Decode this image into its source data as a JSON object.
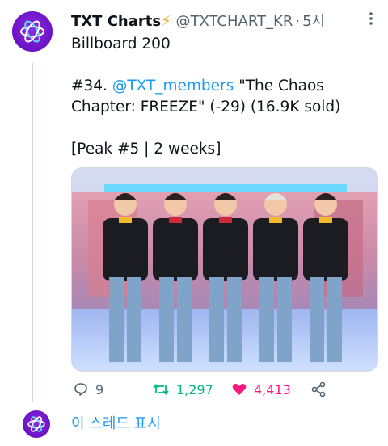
{
  "tweet": {
    "display_name": "TXT Charts",
    "name_emoji": "⚡",
    "handle": "@TXTCHART_KR",
    "separator": "·",
    "time": "5시",
    "line1": "Billboard 200",
    "line2_prefix": "#34. ",
    "mention": "@TXT_members",
    "line2_rest": " \"The Chaos Chapter: FREEZE\" (-29) (16.9K sold)",
    "line3": "[Peak #5  | 2 weeks]"
  },
  "actions": {
    "replies": "9",
    "retweets": "1,297",
    "likes": "4,413"
  },
  "thread": {
    "show_thread_label": "이 스레드 표시"
  },
  "colors": {
    "link": "#1d9bf0",
    "retweet": "#00ba7c",
    "like": "#f91880",
    "avatar": "#6a12c4"
  },
  "icons": [
    "logo-icon",
    "more-icon",
    "reply-icon",
    "retweet-icon",
    "heart-icon",
    "share-icon"
  ]
}
